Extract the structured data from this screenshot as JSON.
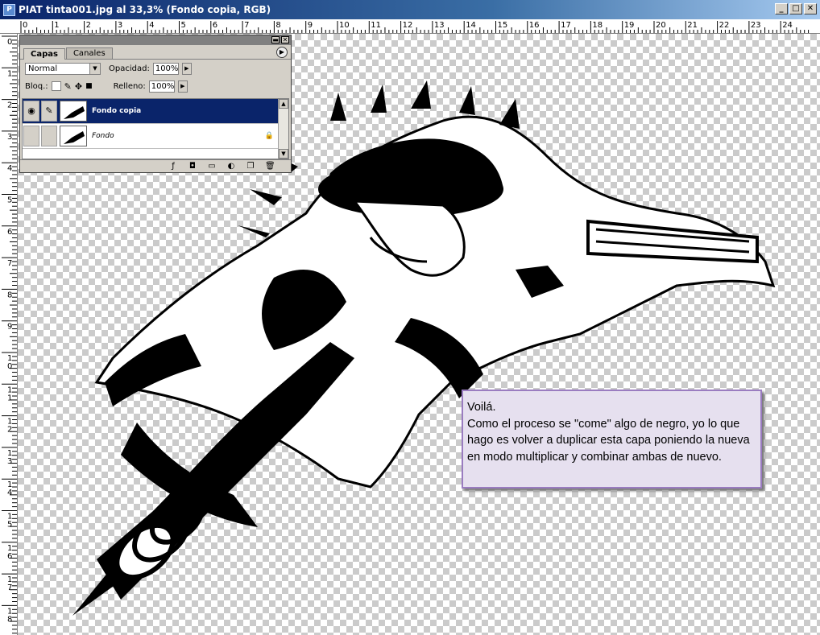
{
  "window": {
    "title": "PIAT tinta001.jpg al 33,3% (Fondo copia, RGB)",
    "min": "_",
    "max": "□",
    "close": "✕"
  },
  "ruler": {
    "top": [
      "0",
      "1",
      "2",
      "3",
      "4",
      "5",
      "6",
      "7",
      "8",
      "9",
      "10",
      "11",
      "12",
      "13",
      "14",
      "15",
      "16",
      "17",
      "18",
      "19",
      "20",
      "21",
      "22",
      "23",
      "24"
    ],
    "left": [
      "0",
      "1",
      "2",
      "3",
      "4",
      "5",
      "6",
      "7",
      "8",
      "9",
      "1 0",
      "1 1",
      "1 2",
      "1 3",
      "1 4",
      "1 5",
      "1 6",
      "1 7",
      "1 8"
    ]
  },
  "panel": {
    "tabs": [
      "Capas",
      "Canales"
    ],
    "blend_mode": "Normal",
    "opacity_label": "Opacidad:",
    "opacity": "100%",
    "lock_label": "Bloq.:",
    "fill_label": "Relleno:",
    "fill": "100%",
    "layers": [
      {
        "name": "Fondo copia",
        "selected": true
      },
      {
        "name": "Fondo",
        "selected": false
      }
    ]
  },
  "note": {
    "line1": "Voilá.",
    "body": "Como el proceso se \"come\" algo de negro, yo lo que hago es volver a duplicar esta capa poniendo la nueva en modo multiplicar y combinar ambas de nuevo."
  },
  "icons": [
    "document-icon",
    "eye-icon",
    "brush-icon",
    "lock-icon",
    "move-icon",
    "layer-style-icon",
    "mask-icon",
    "folder-icon",
    "adjustment-icon",
    "new-layer-icon",
    "trash-icon"
  ]
}
